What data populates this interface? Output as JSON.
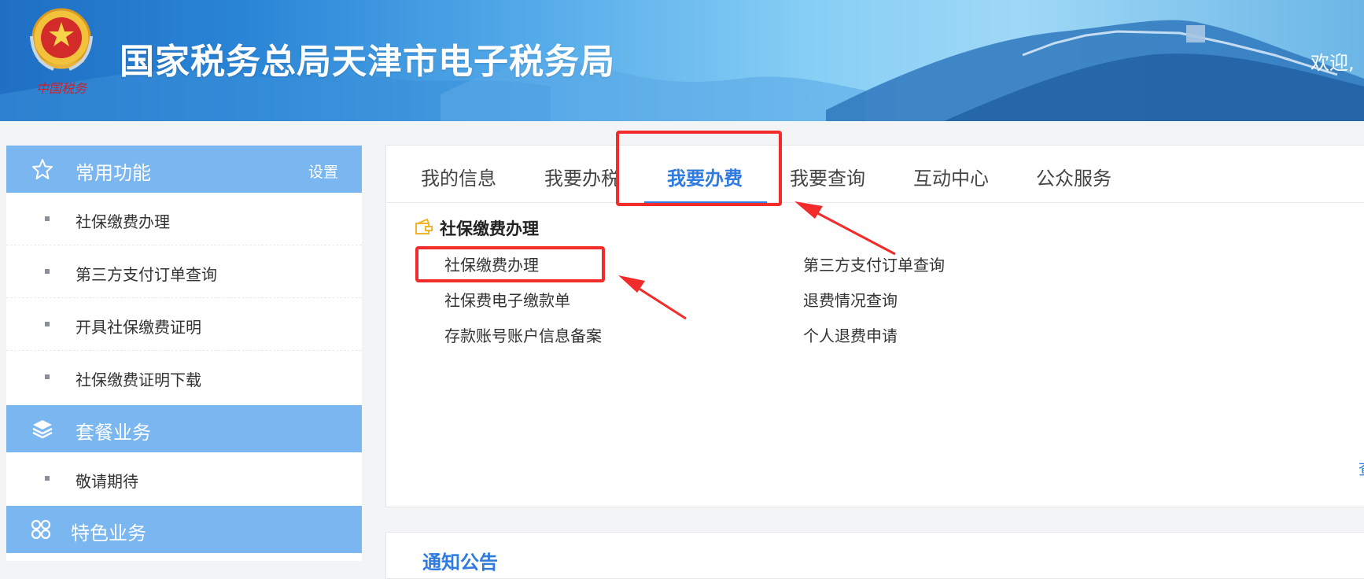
{
  "header": {
    "title": "国家税务总局天津市电子税务局",
    "welcome": "欢迎,",
    "emblem_icon": "national-tax-emblem-icon",
    "emblem_text": "中国税务"
  },
  "sidebar": {
    "sections": [
      {
        "icon": "star-icon",
        "label": "常用功能",
        "action": "设置",
        "items": [
          "社保缴费办理",
          "第三方支付订单查询",
          "开具社保缴费证明",
          "社保缴费证明下载"
        ]
      },
      {
        "icon": "layers-icon",
        "label": "套餐业务",
        "items": [
          "敬请期待"
        ]
      },
      {
        "icon": "grid-icon",
        "label": "特色业务",
        "items": []
      }
    ]
  },
  "main": {
    "tabs": [
      {
        "label": "我的信息",
        "active": false
      },
      {
        "label": "我要办税",
        "active": false
      },
      {
        "label": "我要办费",
        "active": true
      },
      {
        "label": "我要查询",
        "active": false
      },
      {
        "label": "互动中心",
        "active": false
      },
      {
        "label": "公众服务",
        "active": false
      }
    ],
    "section": {
      "icon": "wallet-icon",
      "title": "社保缴费办理",
      "links_left": [
        "社保缴费办理",
        "社保费电子缴款单",
        "存款账号账户信息备案"
      ],
      "links_right": [
        "第三方支付订单查询",
        "退费情况查询",
        "个人退费申请"
      ]
    },
    "more_link": "查"
  },
  "notice": {
    "title": "通知公告"
  },
  "colors": {
    "accent": "#2f7be0",
    "sidebar_header": "#7ab6f0",
    "annotation": "#f22b2b"
  }
}
